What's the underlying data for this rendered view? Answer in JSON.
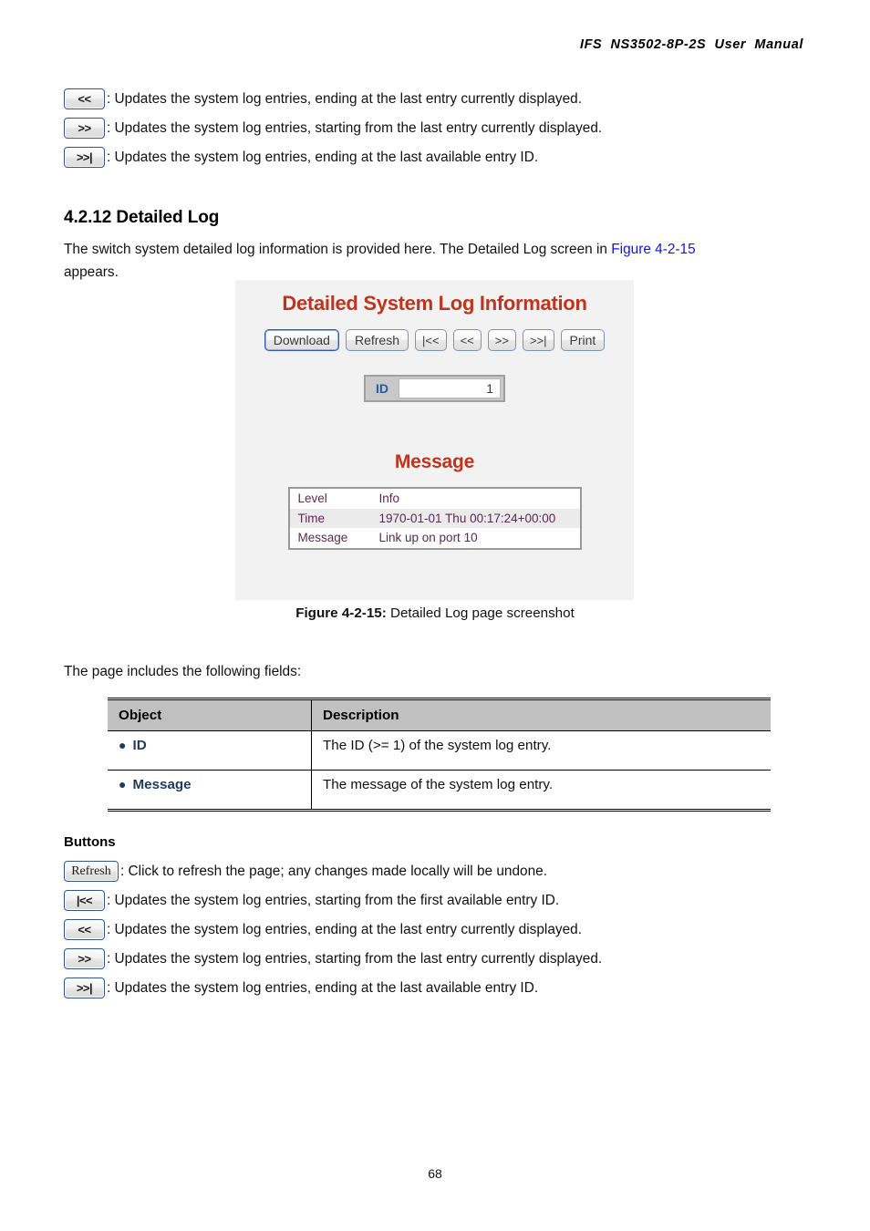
{
  "header": {
    "running_title": "IFS  NS3502-8P-2S  User  Manual"
  },
  "top_buttons": [
    {
      "glyph": "<<",
      "description": ": Updates the system log entries, ending at the last entry currently displayed."
    },
    {
      "glyph": ">>",
      "description": ": Updates the system log entries, starting from the last entry currently displayed."
    },
    {
      "glyph": ">>|",
      "description": ": Updates the system log entries, ending at the last available entry ID."
    }
  ],
  "section": {
    "heading": "4.2.12 Detailed Log",
    "intro_before": "The switch system detailed log information is provided here. The Detailed Log screen in ",
    "intro_link": "Figure 4-2-15",
    "intro_after": "",
    "intro_line2": "appears."
  },
  "figure": {
    "title": "Detailed System Log Information",
    "toolbar": [
      {
        "label": "Download",
        "kind": "primary"
      },
      {
        "label": "Refresh",
        "kind": "normal"
      },
      {
        "label": "|<<",
        "kind": "nav"
      },
      {
        "label": "<<",
        "kind": "nav"
      },
      {
        "label": ">>",
        "kind": "nav"
      },
      {
        "label": ">>|",
        "kind": "nav"
      },
      {
        "label": "Print",
        "kind": "normal"
      }
    ],
    "id_field": {
      "label": "ID",
      "value": "1"
    },
    "message_title": "Message",
    "message_rows": [
      {
        "key": "Level",
        "value": "Info"
      },
      {
        "key": "Time",
        "value": "1970-01-01 Thu 00:17:24+00:00"
      },
      {
        "key": "Message",
        "value": "Link up on port 10"
      }
    ],
    "caption_label": "Figure 4-2-15:",
    "caption_text": " Detailed Log page screenshot"
  },
  "fields": {
    "intro": "The page includes the following fields:",
    "columns": [
      "Object",
      "Description"
    ],
    "rows": [
      {
        "object": "ID",
        "description": "The ID (>= 1) of the system log entry."
      },
      {
        "object": "Message",
        "description": "The message of the system log entry."
      }
    ]
  },
  "buttons_section": {
    "heading": "Buttons",
    "items": [
      {
        "glyph": "Refresh",
        "style": "serif",
        "description": ": Click to refresh the page; any changes made locally will be undone."
      },
      {
        "glyph": "|<<",
        "style": "glyph",
        "description": ": Updates the system log entries, starting from the first available entry ID."
      },
      {
        "glyph": "<<",
        "style": "glyph",
        "description": ": Updates the system log entries, ending at the last entry currently displayed."
      },
      {
        "glyph": ">>",
        "style": "glyph",
        "description": ": Updates the system log entries, starting from the last entry currently displayed."
      },
      {
        "glyph": ">>|",
        "style": "glyph",
        "description": ": Updates the system log entries, ending at the last available entry ID."
      }
    ]
  },
  "footer": {
    "page_number": "68"
  },
  "colors": {
    "heading_red": "#c0341d",
    "link_blue": "#1414e6",
    "object_navy": "#1f3b5c",
    "table_header_gray": "#c0c0c0",
    "figure_bg": "#f2f2f2",
    "message_text": "#5c2952"
  }
}
